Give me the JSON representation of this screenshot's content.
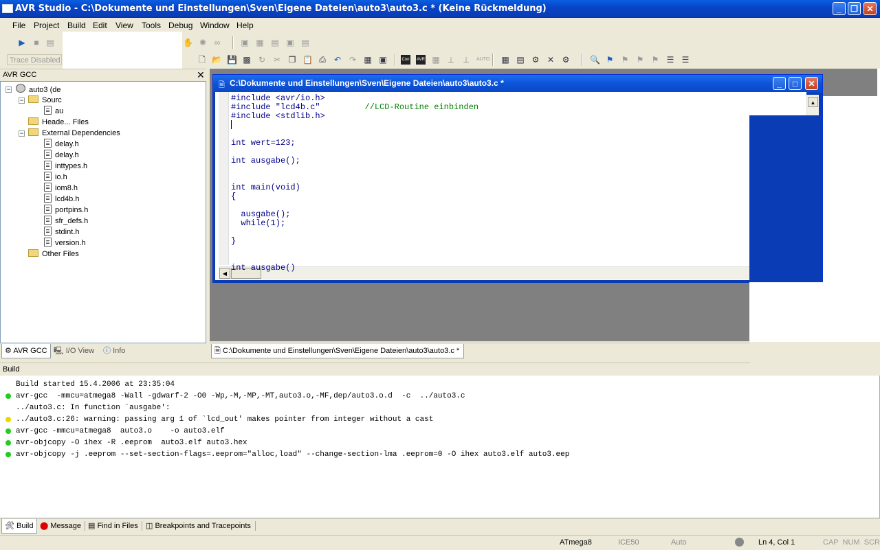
{
  "window": {
    "title": "AVR Studio - C:\\Dokumente und Einstellungen\\Sven\\Eigene Dateien\\auto3\\auto3.c * (Keine Rückmeldung)"
  },
  "menu": [
    "File",
    "Project",
    "Build",
    "Edit",
    "View",
    "Tools",
    "Debug",
    "Window",
    "Help"
  ],
  "toolbar": {
    "trace_label": "Trace Disabled"
  },
  "project_panel": {
    "title": "AVR GCC",
    "items": [
      {
        "label": "auto3 (de",
        "kind": "project"
      },
      {
        "label": "Sourc",
        "kind": "folder"
      },
      {
        "label": "au",
        "kind": "file"
      },
      {
        "label": "Heade... Files",
        "kind": "folder"
      },
      {
        "label": "External Dependencies",
        "kind": "folder"
      },
      {
        "label": "delay.h",
        "kind": "file"
      },
      {
        "label": "delay.h",
        "kind": "file"
      },
      {
        "label": "inttypes.h",
        "kind": "file"
      },
      {
        "label": "io.h",
        "kind": "file"
      },
      {
        "label": "iom8.h",
        "kind": "file"
      },
      {
        "label": "lcd4b.h",
        "kind": "file"
      },
      {
        "label": "portpins.h",
        "kind": "file"
      },
      {
        "label": "sfr_defs.h",
        "kind": "file"
      },
      {
        "label": "stdint.h",
        "kind": "file"
      },
      {
        "label": "version.h",
        "kind": "file"
      },
      {
        "label": "Other Files",
        "kind": "folder"
      }
    ],
    "tabs": [
      "AVR GCC",
      "I/O View",
      "Info"
    ]
  },
  "editor": {
    "title": "C:\\Dokumente und Einstellungen\\Sven\\Eigene Dateien\\auto3\\auto3.c *",
    "doc_tab": "C:\\Dokumente und Einstellungen\\Sven\\Eigene Dateien\\auto3\\auto3.c *",
    "lines": [
      {
        "code": "#include <avr/io.h>",
        "comment": ""
      },
      {
        "code": "#include \"lcd4b.c\"         ",
        "comment": "//LCD-Routine einbinden"
      },
      {
        "code": "#include <stdlib.h>",
        "comment": ""
      },
      {
        "code": "",
        "comment": ""
      },
      {
        "code": "",
        "comment": ""
      },
      {
        "code": "int wert=123;",
        "comment": ""
      },
      {
        "code": "",
        "comment": ""
      },
      {
        "code": "int ausgabe();",
        "comment": ""
      },
      {
        "code": "",
        "comment": ""
      },
      {
        "code": "",
        "comment": ""
      },
      {
        "code": "int main(void)",
        "comment": ""
      },
      {
        "code": "{",
        "comment": ""
      },
      {
        "code": "",
        "comment": ""
      },
      {
        "code": "  ausgabe();",
        "comment": ""
      },
      {
        "code": "  while(1);",
        "comment": ""
      },
      {
        "code": "",
        "comment": ""
      },
      {
        "code": "}",
        "comment": ""
      },
      {
        "code": "",
        "comment": ""
      },
      {
        "code": "",
        "comment": ""
      },
      {
        "code": "int ausgabe()",
        "comment": ""
      }
    ]
  },
  "build_panel": {
    "title": "Build",
    "lines": [
      {
        "text": "Build started 15.4.2006 at 23:35:04",
        "status": "none"
      },
      {
        "text": "avr-gcc  -mmcu=atmega8 -Wall -gdwarf-2 -O0 -Wp,-M,-MP,-MT,auto3.o,-MF,dep/auto3.o.d  -c  ../auto3.c",
        "status": "ok"
      },
      {
        "text": "../auto3.c: In function `ausgabe':",
        "status": "none"
      },
      {
        "text": "../auto3.c:26: warning: passing arg 1 of `lcd_out' makes pointer from integer without a cast",
        "status": "warning"
      },
      {
        "text": "avr-gcc -mmcu=atmega8  auto3.o    -o auto3.elf",
        "status": "ok"
      },
      {
        "text": "avr-objcopy -O ihex -R .eeprom  auto3.elf auto3.hex",
        "status": "ok"
      },
      {
        "text": "avr-objcopy -j .eeprom --set-section-flags=.eeprom=\"alloc,load\" --change-section-lma .eeprom=0 -O ihex auto3.elf auto3.eep",
        "status": "ok"
      }
    ],
    "tabs": [
      "Build",
      "Message",
      "Find in Files",
      "Breakpoints and Tracepoints"
    ]
  },
  "statusbar": {
    "device": "ATmega8",
    "platform": "ICE50",
    "mode": "Auto",
    "position": "Ln 4, Col 1",
    "keys": "CAP  NUM  SCRL"
  },
  "colors": {
    "ok_dot": "#22cc22",
    "warning_dot": "#e8d800",
    "titlebar": "#0a3db5"
  }
}
